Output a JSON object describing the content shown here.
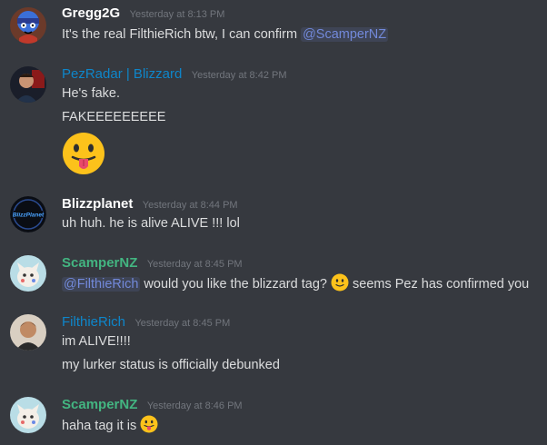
{
  "messages": [
    {
      "username": "Gregg2G",
      "username_color": "#ffffff",
      "timestamp": "Yesterday at 8:13 PM",
      "lines": [
        {
          "text": "It's the real FilthieRich btw, I can confirm ",
          "mention": "@ScamperNZ"
        }
      ]
    },
    {
      "username": "PezRadar | Blizzard",
      "username_color": "#0e86ca",
      "timestamp": "Yesterday at 8:42 PM",
      "lines": [
        {
          "text": "He's fake."
        },
        {
          "text": "FAKEEEEEEEEE"
        }
      ],
      "emoji": "tongue-out-emoji"
    },
    {
      "username": "Blizzplanet",
      "username_color": "#ffffff",
      "timestamp": "Yesterday at 8:44 PM",
      "avatar_text": "BlizzPlanet",
      "lines": [
        {
          "text": "uh huh. he is alive ALIVE !!! lol"
        }
      ]
    },
    {
      "username": "ScamperNZ",
      "username_color": "#43b581",
      "timestamp": "Yesterday at 8:45 PM",
      "lines": [
        {
          "mention": "@FilthieRich",
          "text": " would you like the blizzard tag? ",
          "text_after": " seems Pez has confirmed you"
        }
      ]
    },
    {
      "username": "FilthieRich",
      "username_color": "#0e86ca",
      "timestamp": "Yesterday at 8:45 PM",
      "lines": [
        {
          "text": "im ALIVE!!!!"
        },
        {
          "text": "my lurker status is officially debunked"
        }
      ]
    },
    {
      "username": "ScamperNZ",
      "username_color": "#43b581",
      "timestamp": "Yesterday at 8:46 PM",
      "lines": [
        {
          "text": "haha tag it is "
        }
      ]
    }
  ]
}
